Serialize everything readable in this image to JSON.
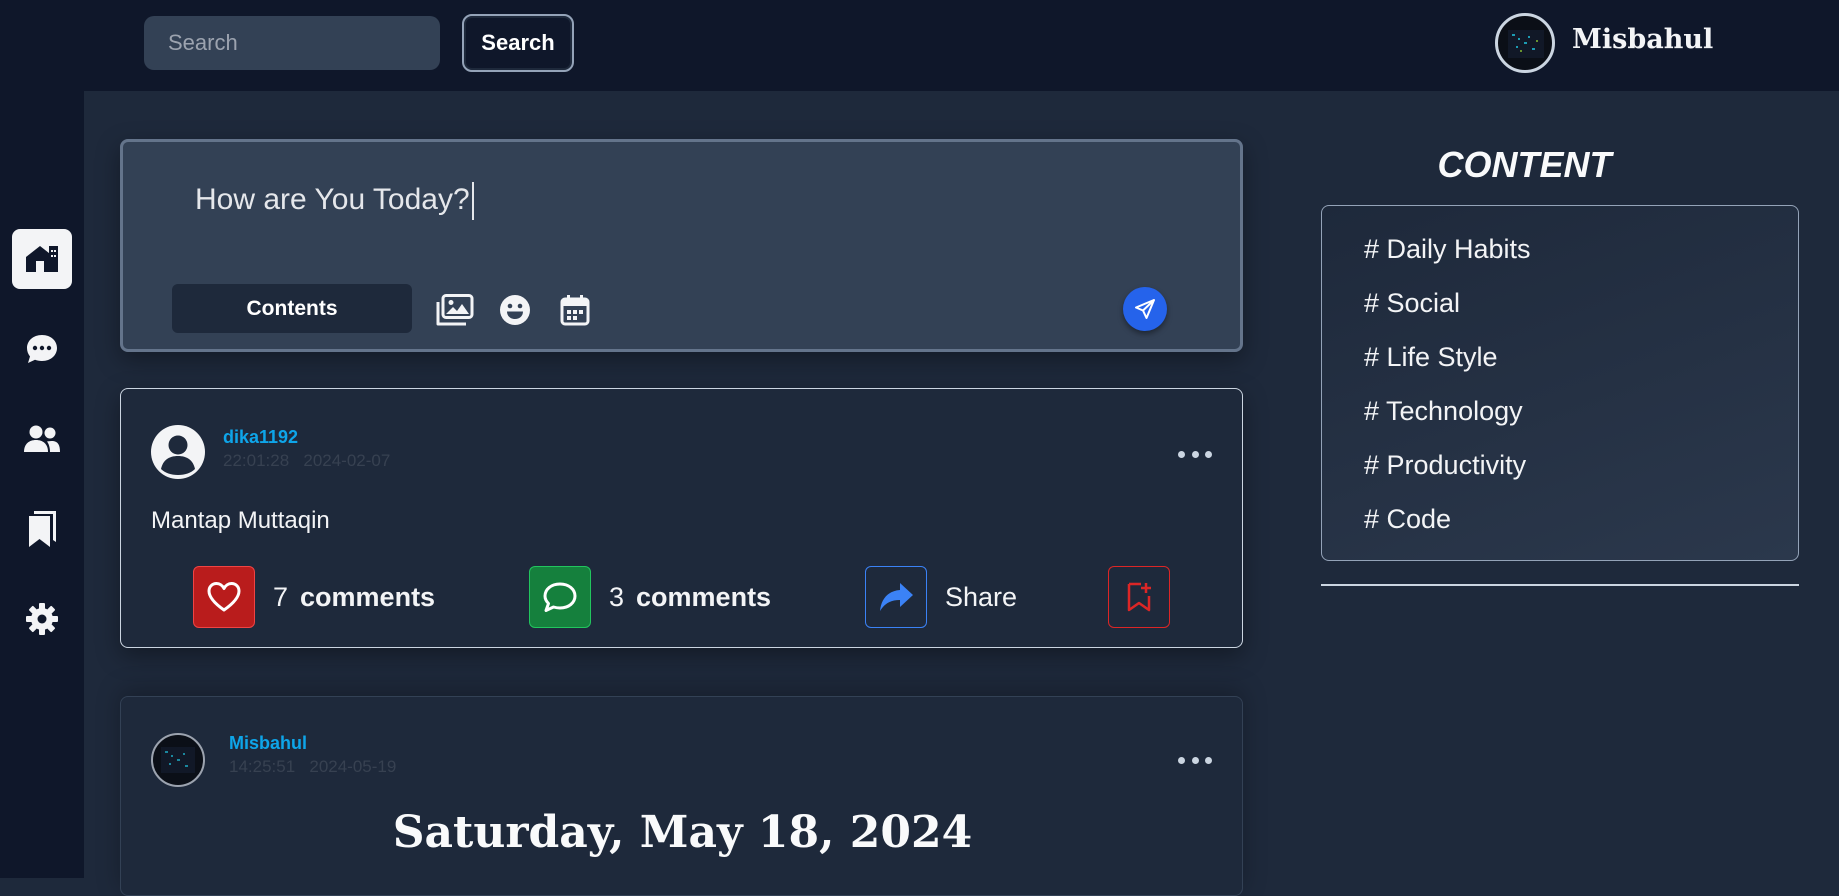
{
  "header": {
    "search_placeholder": "Search",
    "search_button": "Search",
    "profile_name": "Misbahul"
  },
  "sidebar": {
    "items": [
      {
        "icon": "home-icon",
        "active": true
      },
      {
        "icon": "chat-icon",
        "active": false
      },
      {
        "icon": "users-icon",
        "active": false
      },
      {
        "icon": "bookmarks-icon",
        "active": false
      },
      {
        "icon": "gear-icon",
        "active": false
      }
    ]
  },
  "composer": {
    "text": "How are You Today?",
    "contents_button": "Contents",
    "tools": [
      "images-icon",
      "emoji-icon",
      "calendar-icon"
    ],
    "send_icon": "send-icon"
  },
  "posts": [
    {
      "username": "dika1192",
      "time": "22:01:28",
      "date": "2024-02-07",
      "text": "Mantap Muttaqin",
      "likes_count": "7",
      "likes_label": "comments",
      "comments_count": "3",
      "comments_label": "comments",
      "share_label": "Share"
    },
    {
      "username": "Misbahul",
      "time": "14:25:51",
      "date": "2024-05-19",
      "heading": "Saturday, May 18, 2024"
    }
  ],
  "content_panel": {
    "title": "CONTENT",
    "items": [
      "# Daily Habits",
      "# Social",
      "# Life Style",
      "# Technology",
      "# Productivity",
      "# Code"
    ]
  },
  "colors": {
    "accent": "#2563eb",
    "like": "#b91c1c",
    "comment": "#15803d",
    "username": "#0ea5e9"
  }
}
